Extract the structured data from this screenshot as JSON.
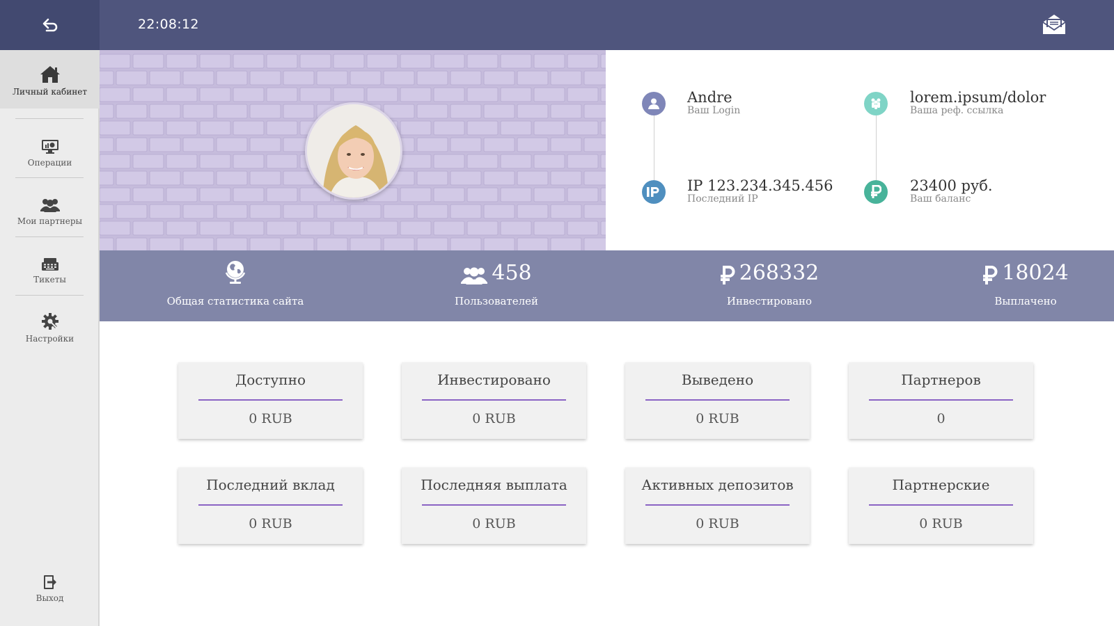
{
  "header": {
    "time": "22:08:12"
  },
  "sidebar": {
    "items": [
      {
        "label": "Личный кабинет"
      },
      {
        "label": "Операции"
      },
      {
        "label": "Мои партнеры"
      },
      {
        "label": "Тикеты"
      },
      {
        "label": "Настройки"
      }
    ],
    "logout": "Выход"
  },
  "profile": {
    "login": {
      "value": "Andre",
      "label": "Ваш Login"
    },
    "ip": {
      "value": "IP 123.234.345.456",
      "label": "Последний IP"
    },
    "ref": {
      "value": "lorem.ipsum/dolor",
      "label": "Ваша реф. ссылка"
    },
    "balance": {
      "value": "23400 руб.",
      "label": "Ваш баланс"
    }
  },
  "stats": {
    "site": {
      "caption": "Общая статистика сайта"
    },
    "users": {
      "value": "458",
      "caption": "Пользователей"
    },
    "invested": {
      "value": "268332",
      "caption": "Инвестировано"
    },
    "paid": {
      "value": "18024",
      "caption": "Выплачено"
    }
  },
  "cards": [
    {
      "title": "Доступно",
      "value": "0 RUB"
    },
    {
      "title": "Инвестировано",
      "value": "0 RUB"
    },
    {
      "title": "Выведено",
      "value": "0 RUB"
    },
    {
      "title": "Партнеров",
      "value": "0"
    },
    {
      "title": "Последний вклад",
      "value": "0 RUB"
    },
    {
      "title": "Последняя выплата",
      "value": "0 RUB"
    },
    {
      "title": "Активных депозитов",
      "value": "0 RUB"
    },
    {
      "title": "Партнерские",
      "value": "0 RUB"
    }
  ],
  "colors": {
    "topbar": "#4f557d",
    "stats_strip": "#8186a8",
    "accent_purple": "#8a63c4",
    "login_icon": "#7f86b8",
    "ip_icon": "#4f8fbf",
    "ref_icon": "#7fd4c6",
    "balance_icon": "#48b39a"
  },
  "icons": {
    "back": "undo-arrow-icon",
    "mail": "envelope-open-icon",
    "home": "home-icon",
    "operations": "monitor-chart-icon",
    "partners": "users-icon",
    "tickets": "keyboard-icon",
    "settings": "gear-icon",
    "logout": "sign-out-icon",
    "site_stats": "globe-icon",
    "ruble": "ruble-icon"
  }
}
